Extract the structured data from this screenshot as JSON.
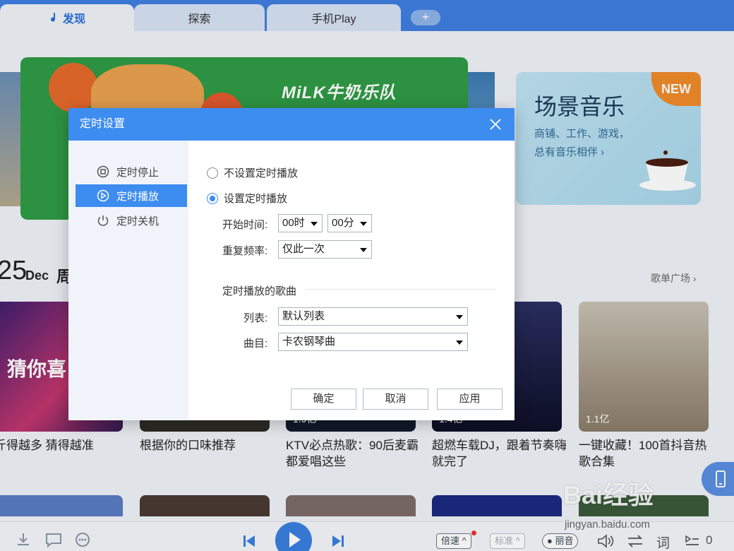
{
  "tabs": [
    {
      "label": "发现",
      "active": true
    },
    {
      "label": "探索",
      "active": false
    },
    {
      "label": "手机Play",
      "active": false
    }
  ],
  "tab_add": "+",
  "banner": {
    "main_text": "MiLK牛奶乐队",
    "scene": {
      "title": "场景音乐",
      "line1": "商铺、工作、游戏，",
      "line2": "总有音乐相伴 ›",
      "badge": "NEW"
    }
  },
  "section": {
    "day": "25",
    "month": "Dec",
    "week_partial": "周",
    "link": "歌单广场 ›"
  },
  "cards": [
    {
      "title": "斤得越多 猜得越准",
      "overlay": "猜你喜",
      "count": ""
    },
    {
      "title": "根据你的口味推荐",
      "overlay": "",
      "count": ""
    },
    {
      "title": "KTV必点热歌：90后麦霸都爱唱这些",
      "overlay": "",
      "count": "1.9亿"
    },
    {
      "title": "超燃车载DJ，跟着节奏嗨就完了",
      "overlay": "",
      "count": "1.4亿"
    },
    {
      "title": "一键收藏！100首抖音热歌合集",
      "overlay": "",
      "count": "1.1亿"
    }
  ],
  "player": {
    "speed": "倍速",
    "quality": "标准",
    "sound": "丽音",
    "lyrics": "词",
    "playlist_count": "0"
  },
  "watermark": {
    "logo": "Bai经验",
    "url": "jingyan.baidu.com"
  },
  "dialog": {
    "title": "定时设置",
    "side": [
      {
        "label": "定时停止",
        "icon": "stop-timer-icon",
        "active": false
      },
      {
        "label": "定时播放",
        "icon": "play-timer-icon",
        "active": true
      },
      {
        "label": "定时关机",
        "icon": "power-icon",
        "active": false
      }
    ],
    "options": {
      "no_schedule": "不设置定时播放",
      "schedule": "设置定时播放",
      "selected": "schedule"
    },
    "start_time_label": "开始时间:",
    "hour": "00时",
    "minute": "00分",
    "repeat_label": "重复频率:",
    "repeat": "仅此一次",
    "songs_section": "定时播放的歌曲",
    "list_label": "列表:",
    "list_value": "默认列表",
    "track_label": "曲目:",
    "track_value": "卡农钢琴曲",
    "buttons": {
      "ok": "确定",
      "cancel": "取消",
      "apply": "应用"
    }
  }
}
